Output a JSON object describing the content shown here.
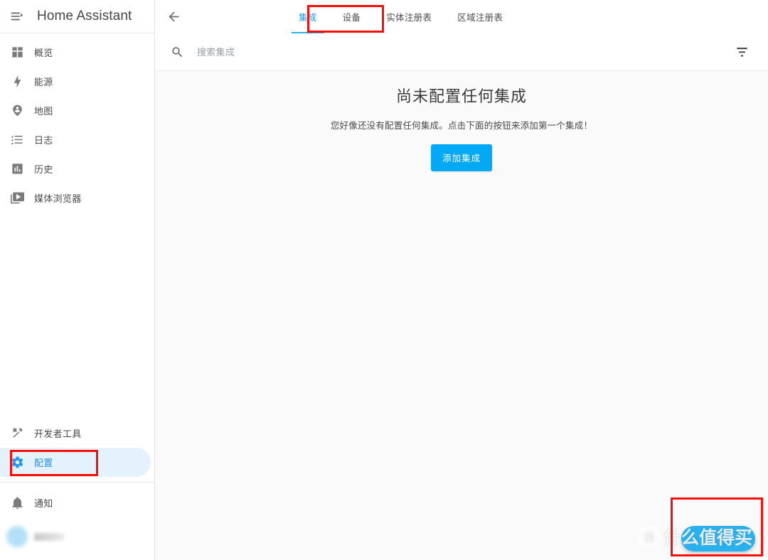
{
  "app": {
    "title": "Home Assistant",
    "accent_color": "#2196f3",
    "fab_color": "#29b1ef",
    "button_color": "#03a9f4",
    "annotation_color": "#fb0d09",
    "selected_bg": "#e3f2fd",
    "content_bg": "#fafafa"
  },
  "sidebar": {
    "menu_icon": "menu-open-icon",
    "items": [
      {
        "label": "概览",
        "icon": "view-dashboard-icon",
        "selected": false
      },
      {
        "label": "能源",
        "icon": "lightning-bolt-icon",
        "selected": false
      },
      {
        "label": "地图",
        "icon": "map-marker-account-icon",
        "selected": false
      },
      {
        "label": "日志",
        "icon": "format-list-bulleted-icon",
        "selected": false
      },
      {
        "label": "历史",
        "icon": "chart-box-icon",
        "selected": false
      },
      {
        "label": "媒体浏览器",
        "icon": "play-box-multiple-icon",
        "selected": false
      }
    ],
    "bottom_items": [
      {
        "label": "开发者工具",
        "icon": "hammer-wrench-icon",
        "selected": false
      },
      {
        "label": "配置",
        "icon": "cog-icon",
        "selected": true
      }
    ],
    "notifications": {
      "label": "通知",
      "icon": "bell-icon"
    },
    "user": {
      "name": "",
      "redacted": true,
      "avatar_icon": "avatar"
    }
  },
  "toolbar": {
    "back_icon": "arrow-left-icon",
    "tabs": [
      {
        "label": "集成",
        "active": true
      },
      {
        "label": "设备",
        "active": false
      },
      {
        "label": "实体注册表",
        "active": false
      },
      {
        "label": "区域注册表",
        "active": false
      }
    ]
  },
  "search": {
    "icon": "search-icon",
    "value": "",
    "placeholder": "搜索集成",
    "filter_icon": "filter-variant-icon"
  },
  "main": {
    "empty_title": "尚未配置任何集成",
    "empty_subtitle": "您好像还没有配置任何集成。点击下面的按钮来添加第一个集成！",
    "add_button": "添加集成"
  },
  "fab": {
    "label": "",
    "icon": "plus-icon"
  },
  "watermark": {
    "logo_text": "值",
    "text": "什么值得买"
  }
}
